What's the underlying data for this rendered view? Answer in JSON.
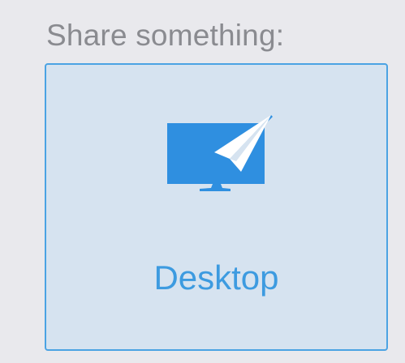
{
  "share": {
    "heading": "Share something:",
    "options": [
      {
        "label": "Desktop",
        "icon": "desktop-share-icon"
      }
    ]
  },
  "colors": {
    "background": "#e9e9ed",
    "heading_text": "#8a8b90",
    "tile_background": "#d6e3f0",
    "tile_border": "#4ba3e3",
    "accent": "#2f8fe0",
    "label_text": "#3d9be0"
  }
}
